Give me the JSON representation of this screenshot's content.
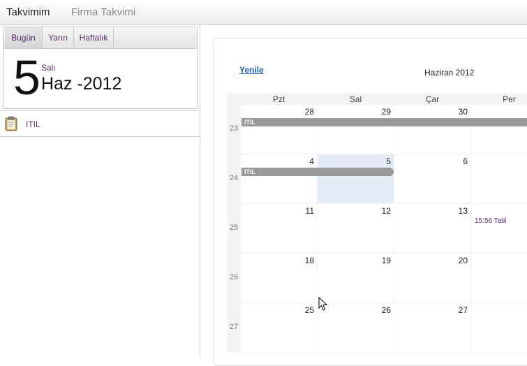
{
  "top_tabs": [
    "Takvimim",
    "Firma Takvimi"
  ],
  "day_tabs": [
    "Bugün",
    "Yarın",
    "Haftalık"
  ],
  "today": {
    "day": "5",
    "day_name": "Salı",
    "month_year": "Haz -2012"
  },
  "event_list": [
    {
      "label": "ITIL",
      "icon": "clipboard-icon"
    }
  ],
  "calendar": {
    "refresh": "Yenile",
    "title": "Haziran 2012",
    "weekdays": [
      "Pzt",
      "Sal",
      "Çar",
      "Per"
    ],
    "weeks": [
      {
        "week": "23",
        "days": [
          "28",
          "29",
          "30",
          ""
        ]
      },
      {
        "week": "24",
        "days": [
          "4",
          "5",
          "6",
          ""
        ]
      },
      {
        "week": "25",
        "days": [
          "11",
          "12",
          "13",
          ""
        ]
      },
      {
        "week": "26",
        "days": [
          "18",
          "19",
          "20",
          ""
        ]
      },
      {
        "week": "27",
        "days": [
          "25",
          "26",
          "27",
          ""
        ]
      }
    ],
    "events": [
      {
        "label": "ITIL"
      },
      {
        "label": "ITIL"
      },
      {
        "label": "15:56 Tatil"
      }
    ]
  }
}
